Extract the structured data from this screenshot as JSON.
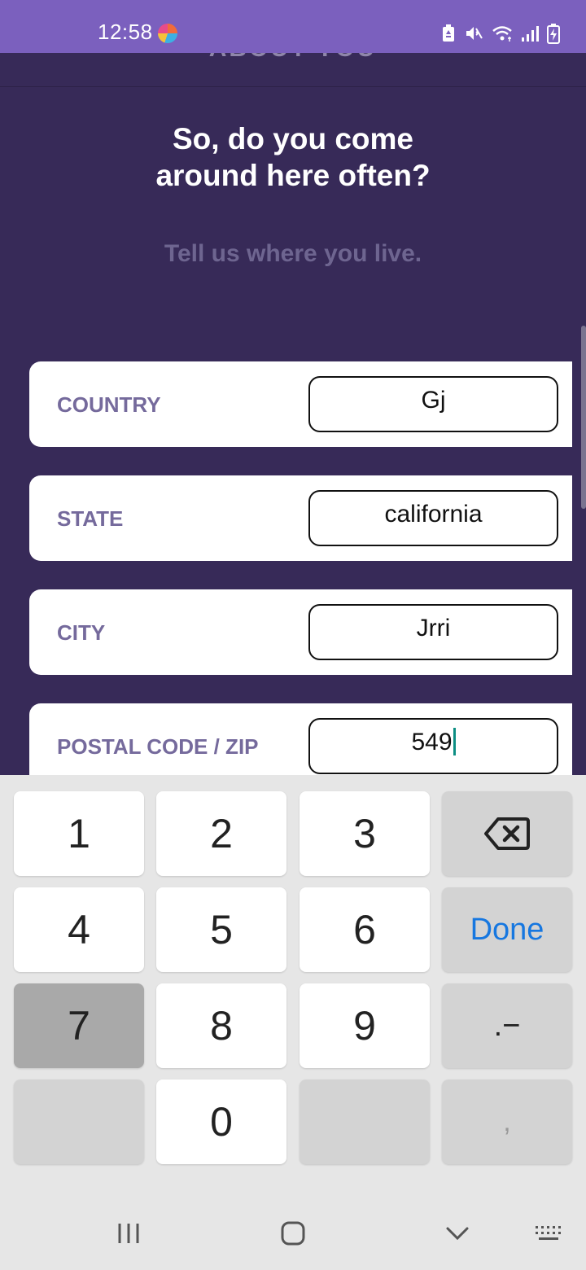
{
  "status_bar": {
    "time": "12:58"
  },
  "header": {
    "title": "ABOUT YOU"
  },
  "heading": {
    "line1": "So, do you come",
    "line2": "around here often?"
  },
  "subheading": "Tell us where you live.",
  "fields": [
    {
      "label": "COUNTRY",
      "value": "Gj"
    },
    {
      "label": "STATE",
      "value": "california"
    },
    {
      "label": "CITY",
      "value": "Jrri"
    },
    {
      "label": "POSTAL CODE / ZIP",
      "value": "549"
    }
  ],
  "keyboard": {
    "keys": {
      "k1": "1",
      "k2": "2",
      "k3": "3",
      "k4": "4",
      "k5": "5",
      "k6": "6",
      "k7": "7",
      "k8": "8",
      "k9": "9",
      "k0": "0",
      "done": "Done",
      "dot_dash": ".−",
      "comma": ","
    },
    "pressed_key": "7"
  },
  "icons": {
    "backspace": "backspace-icon",
    "recents": "recent-apps-icon",
    "home": "home-icon",
    "back": "back-chevron-icon",
    "keyboard": "keyboard-icon"
  },
  "colors": {
    "status_bar": "#7B60BE",
    "background": "#372A58",
    "label": "#756A9C",
    "caret": "#0C8E83",
    "done": "#1677E0"
  }
}
